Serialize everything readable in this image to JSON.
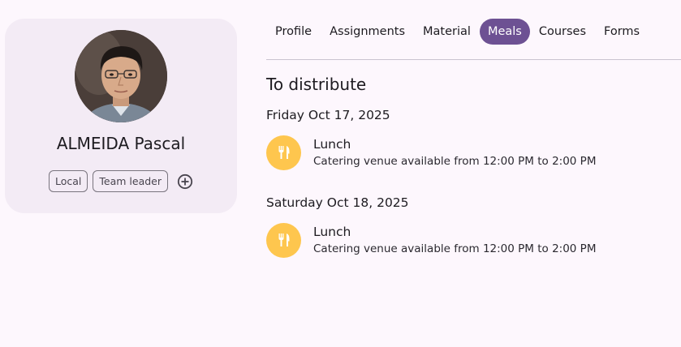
{
  "profile": {
    "name": "ALMEIDA Pascal",
    "tags": [
      "Local",
      "Team leader"
    ]
  },
  "tabs": [
    {
      "label": "Profile",
      "active": false
    },
    {
      "label": "Assignments",
      "active": false
    },
    {
      "label": "Material",
      "active": false
    },
    {
      "label": "Meals",
      "active": true
    },
    {
      "label": "Courses",
      "active": false
    },
    {
      "label": "Forms",
      "active": false
    }
  ],
  "meals_section": {
    "title": "To distribute",
    "days": [
      {
        "date": "Friday Oct 17, 2025",
        "meals": [
          {
            "name": "Lunch",
            "description": "Catering venue available from 12:00 PM to 2:00 PM",
            "icon": "utensils-icon"
          }
        ]
      },
      {
        "date": "Saturday Oct 18, 2025",
        "meals": [
          {
            "name": "Lunch",
            "description": "Catering venue available from 12:00 PM to 2:00 PM",
            "icon": "utensils-icon"
          }
        ]
      }
    ]
  },
  "colors": {
    "accent": "#6d5193",
    "meal_icon_bg": "#fec64e",
    "card_bg": "#f3ebf5",
    "page_bg": "#fdf7fd"
  }
}
